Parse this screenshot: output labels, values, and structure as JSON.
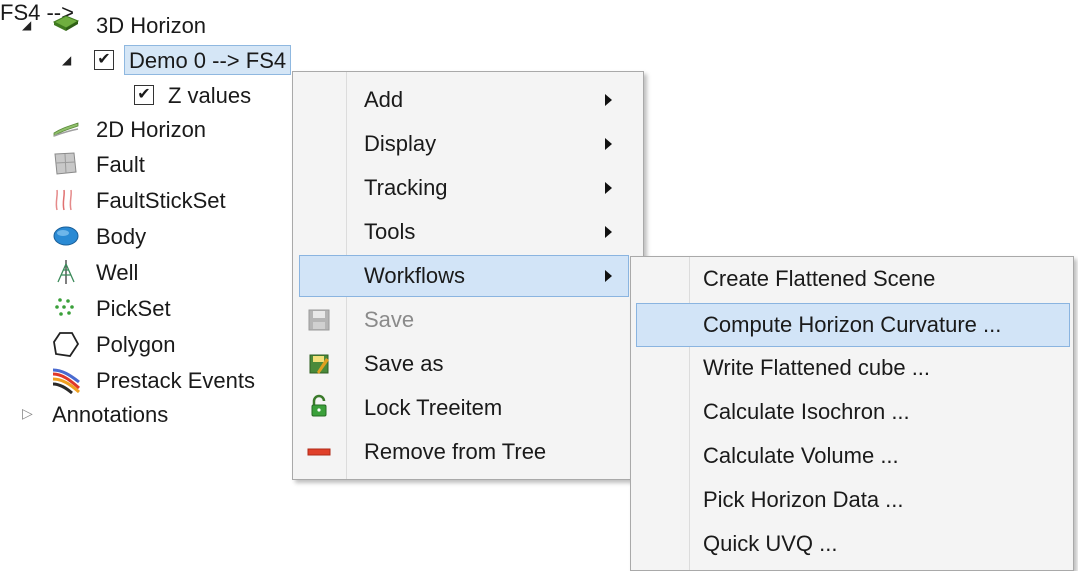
{
  "tree": {
    "items": [
      {
        "label": "3D Horizon"
      },
      {
        "label": "Demo 0 --> FS4"
      },
      {
        "label": "Z values"
      },
      {
        "label": "2D Horizon"
      },
      {
        "label": "Fault"
      },
      {
        "label": "FaultStickSet"
      },
      {
        "label": "Body"
      },
      {
        "label": "Well"
      },
      {
        "label": "PickSet"
      },
      {
        "label": "Polygon"
      },
      {
        "label": "Prestack Events"
      },
      {
        "label": "Annotations"
      }
    ],
    "checkmark": "✔"
  },
  "context_menu": {
    "items": [
      {
        "label": "Add"
      },
      {
        "label": "Display"
      },
      {
        "label": "Tracking"
      },
      {
        "label": "Tools"
      },
      {
        "label": "Workflows"
      },
      {
        "label": "Save"
      },
      {
        "label": "Save as"
      },
      {
        "label": "Lock Treeitem"
      },
      {
        "label": "Remove from Tree"
      }
    ]
  },
  "workflows_menu": {
    "items": [
      {
        "label": "Create Flattened Scene"
      },
      {
        "label": "Compute Horizon Curvature ..."
      },
      {
        "label": "Write Flattened cube ..."
      },
      {
        "label": "Calculate Isochron ..."
      },
      {
        "label": "Calculate Volume ..."
      },
      {
        "label": "Pick Horizon Data ..."
      },
      {
        "label": "Quick UVQ ..."
      }
    ]
  },
  "colors": {
    "highlight": "#d2e4f7",
    "highlight_border": "#8ab4e0",
    "menu_bg": "#f4f4f4"
  }
}
